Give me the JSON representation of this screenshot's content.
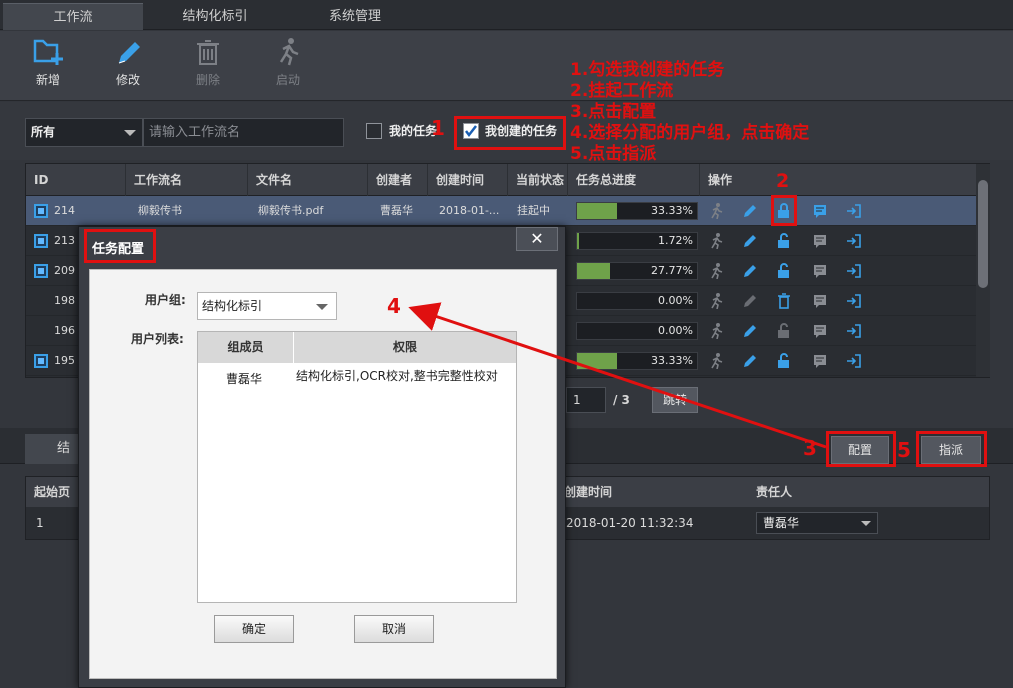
{
  "top_tabs": [
    "工作流",
    "结构化标引",
    "系统管理"
  ],
  "toolbar": {
    "new": "新增",
    "edit": "修改",
    "delete": "删除",
    "start": "启动"
  },
  "filter": {
    "status_select": "所有",
    "search_placeholder": "请输入工作流名",
    "my_tasks": "我的任务",
    "my_created_tasks": "我创建的任务"
  },
  "grid": {
    "columns": [
      "ID",
      "工作流名",
      "文件名",
      "创建者",
      "创建时间",
      "当前状态",
      "任务总进度",
      "操作"
    ],
    "rows": [
      {
        "id": "214",
        "name": "柳毅传书",
        "file": "柳毅传书.pdf",
        "creator": "曹磊华",
        "created": "2018-01-...",
        "status": "挂起中",
        "progress_pct": 33.33,
        "progress_label": "33.33%",
        "checked": true
      },
      {
        "id": "213",
        "name": "",
        "file": "",
        "creator": "",
        "created": "",
        "status": "",
        "progress_pct": 1.72,
        "progress_label": "1.72%",
        "checked": true
      },
      {
        "id": "209",
        "name": "",
        "file": "",
        "creator": "",
        "created": "",
        "status": "",
        "progress_pct": 27.77,
        "progress_label": "27.77%",
        "checked": true
      },
      {
        "id": "198",
        "name": "",
        "file": "",
        "creator": "",
        "created": "",
        "status": "",
        "progress_pct": 0,
        "progress_label": "0.00%",
        "checked": false
      },
      {
        "id": "196",
        "name": "",
        "file": "",
        "creator": "",
        "created": "",
        "status": "",
        "progress_pct": 0,
        "progress_label": "0.00%",
        "checked": false
      },
      {
        "id": "195",
        "name": "",
        "file": "",
        "creator": "",
        "created": "",
        "status": "",
        "progress_pct": 33.33,
        "progress_label": "33.33%",
        "checked": true
      }
    ]
  },
  "pager": {
    "page": "1",
    "total": "/ 3",
    "jump": "跳转"
  },
  "bottom": {
    "tab": "结",
    "config_button": "配置",
    "assign_button": "指派",
    "columns": [
      "起始页",
      "创建时间",
      "责任人"
    ],
    "row": {
      "start_page": "1",
      "created": "2018-01-20 11:32:34",
      "owner": "曹磊华"
    }
  },
  "dialog": {
    "title": "任务配置",
    "close": "✕",
    "group_label": "用户组:",
    "group_value": "结构化标引",
    "users_label": "用户列表:",
    "table_headers": [
      "组成员",
      "权限"
    ],
    "members": [
      {
        "name": "曹磊华",
        "permissions": "结构化标引,OCR校对,整书完整性校对"
      }
    ],
    "ok": "确定",
    "cancel": "取消"
  },
  "annotations": {
    "steps": [
      "1.勾选我创建的任务",
      "2.挂起工作流",
      "3.点击配置",
      "4.选择分配的用户组，点击确定",
      "5.点击指派"
    ],
    "markers": [
      "1",
      "2",
      "3",
      "4",
      "5"
    ]
  },
  "colors": {
    "accent": "#3aa0e8",
    "progress": "#6fa24a",
    "annotation": "#e01010"
  }
}
